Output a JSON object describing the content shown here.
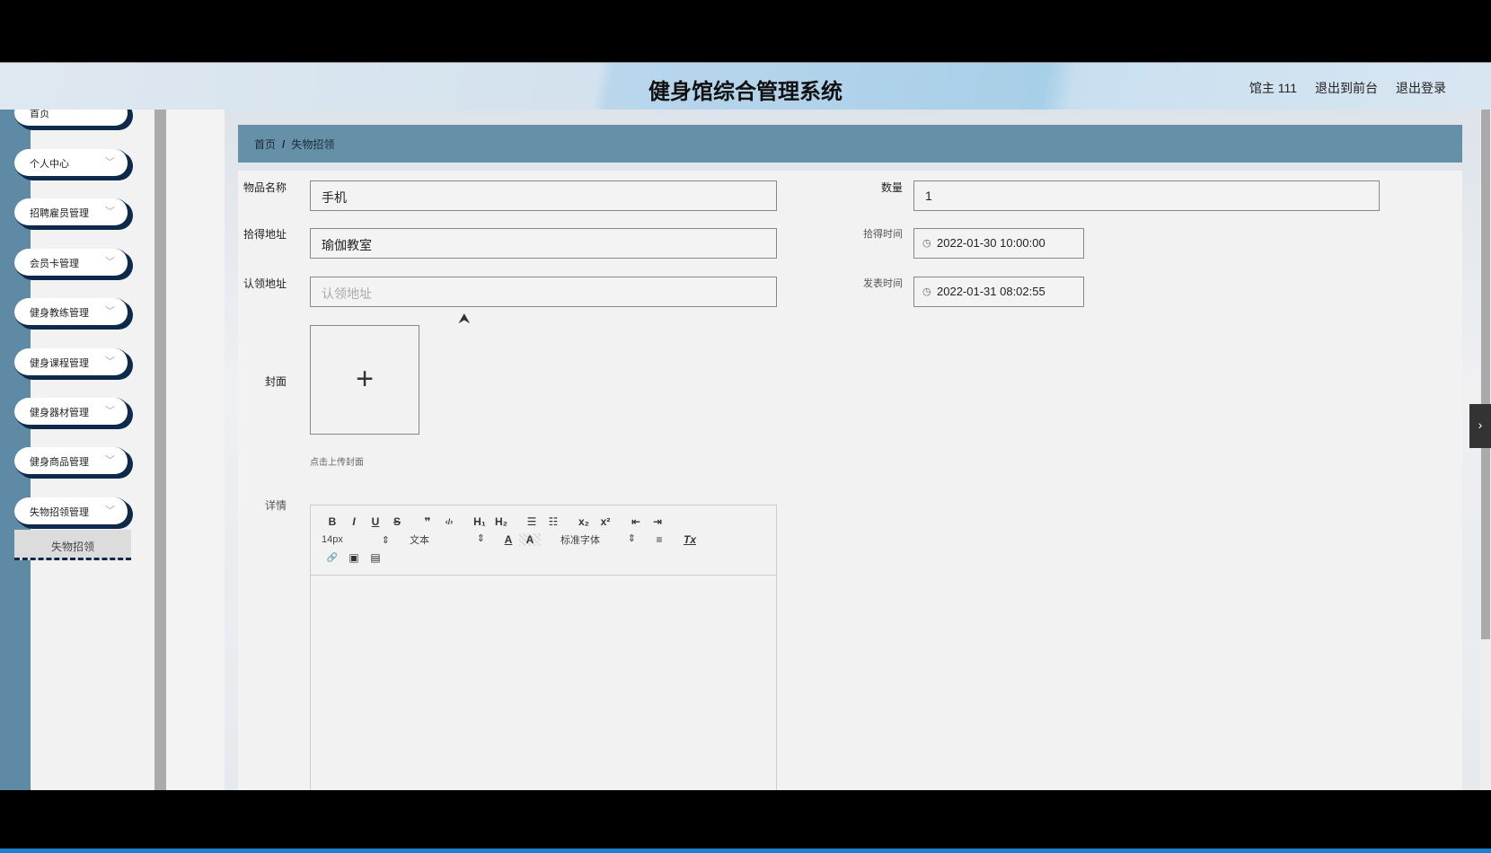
{
  "header": {
    "title": "健身馆综合管理系统",
    "user": "馆主 111",
    "to_front": "退出到前台",
    "logout": "退出登录"
  },
  "sidebar": {
    "items": [
      {
        "label": "首页"
      },
      {
        "label": "个人中心"
      },
      {
        "label": "招聘雇员管理"
      },
      {
        "label": "会员卡管理"
      },
      {
        "label": "健身教练管理"
      },
      {
        "label": "健身课程管理"
      },
      {
        "label": "健身器材管理"
      },
      {
        "label": "健身商品管理"
      },
      {
        "label": "失物招领管理"
      }
    ],
    "sub_item": "失物招领"
  },
  "breadcrumb": {
    "home": "首页",
    "sep": "/",
    "current": "失物招领"
  },
  "form": {
    "name_label": "物品名称",
    "name_value": "手机",
    "qty_label": "数量",
    "qty_value": "1",
    "found_addr_label": "拾得地址",
    "found_addr_value": "瑜伽教室",
    "found_time_label": "拾得时间",
    "found_time_value": "2022-01-30 10:00:00",
    "claim_addr_label": "认领地址",
    "claim_addr_placeholder": "认领地址",
    "post_time_label": "发表时间",
    "post_time_value": "2022-01-31 08:02:55",
    "cover_label": "封面",
    "upload_plus": "+",
    "upload_hint": "点击上传封面",
    "detail_label": "详情"
  },
  "editor": {
    "row1": [
      "B",
      "I",
      "U",
      "S",
      "❞",
      "‹/›",
      "H₁",
      "H₂",
      "☰",
      "☷",
      "x₂",
      "x²",
      "⇤",
      "⇥"
    ],
    "size": "14px",
    "header": "文本",
    "color_a": "A",
    "bg_a": "A",
    "font": "标准字体",
    "align": "≡",
    "clear": "Tx",
    "row3": [
      "🔗",
      "▣",
      "▤"
    ],
    "sel_arrow": "⇕"
  }
}
